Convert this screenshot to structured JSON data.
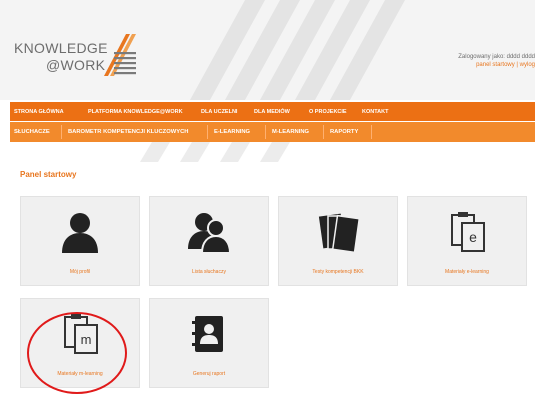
{
  "header": {
    "logo_line1": "KNOWLEDGE",
    "logo_line2": "@WORK",
    "user_info": "Zalogowany jako: dddd dddd",
    "user_links": "panel startowy | wylog"
  },
  "nav_primary": [
    {
      "label": "STRONA GŁÓWNA"
    },
    {
      "label": "PLATFORMA KNOWLEDGE@WORK"
    },
    {
      "label": "DLA UCZELNI"
    },
    {
      "label": "DLA MEDIÓW"
    },
    {
      "label": "O PROJEKCIE"
    },
    {
      "label": "KONTAKT"
    }
  ],
  "nav_secondary": [
    {
      "label": "SŁUCHACZE"
    },
    {
      "label": "BAROMETR KOMPETENCJI KLUCZOWYCH"
    },
    {
      "label": "E-LEARNING"
    },
    {
      "label": "M-LEARNING"
    },
    {
      "label": "RAPORTY"
    }
  ],
  "page_title": "Panel startowy",
  "tiles": [
    {
      "label": "Mój profil",
      "icon": "user-icon"
    },
    {
      "label": "Lista słuchaczy",
      "icon": "users-icon"
    },
    {
      "label": "Testy kompetencji BKK",
      "icon": "documents-icon"
    },
    {
      "label": "Materiały e-learning",
      "icon": "clipboard-e-icon"
    },
    {
      "label": "Materiały m-learning",
      "icon": "clipboard-m-icon"
    },
    {
      "label": "Generuj raport",
      "icon": "address-book-icon"
    }
  ],
  "colors": {
    "nav_primary": "#ec7014",
    "nav_secondary": "#f28a2c",
    "accent": "#e8761f",
    "highlight_circle": "#e01a1a"
  }
}
